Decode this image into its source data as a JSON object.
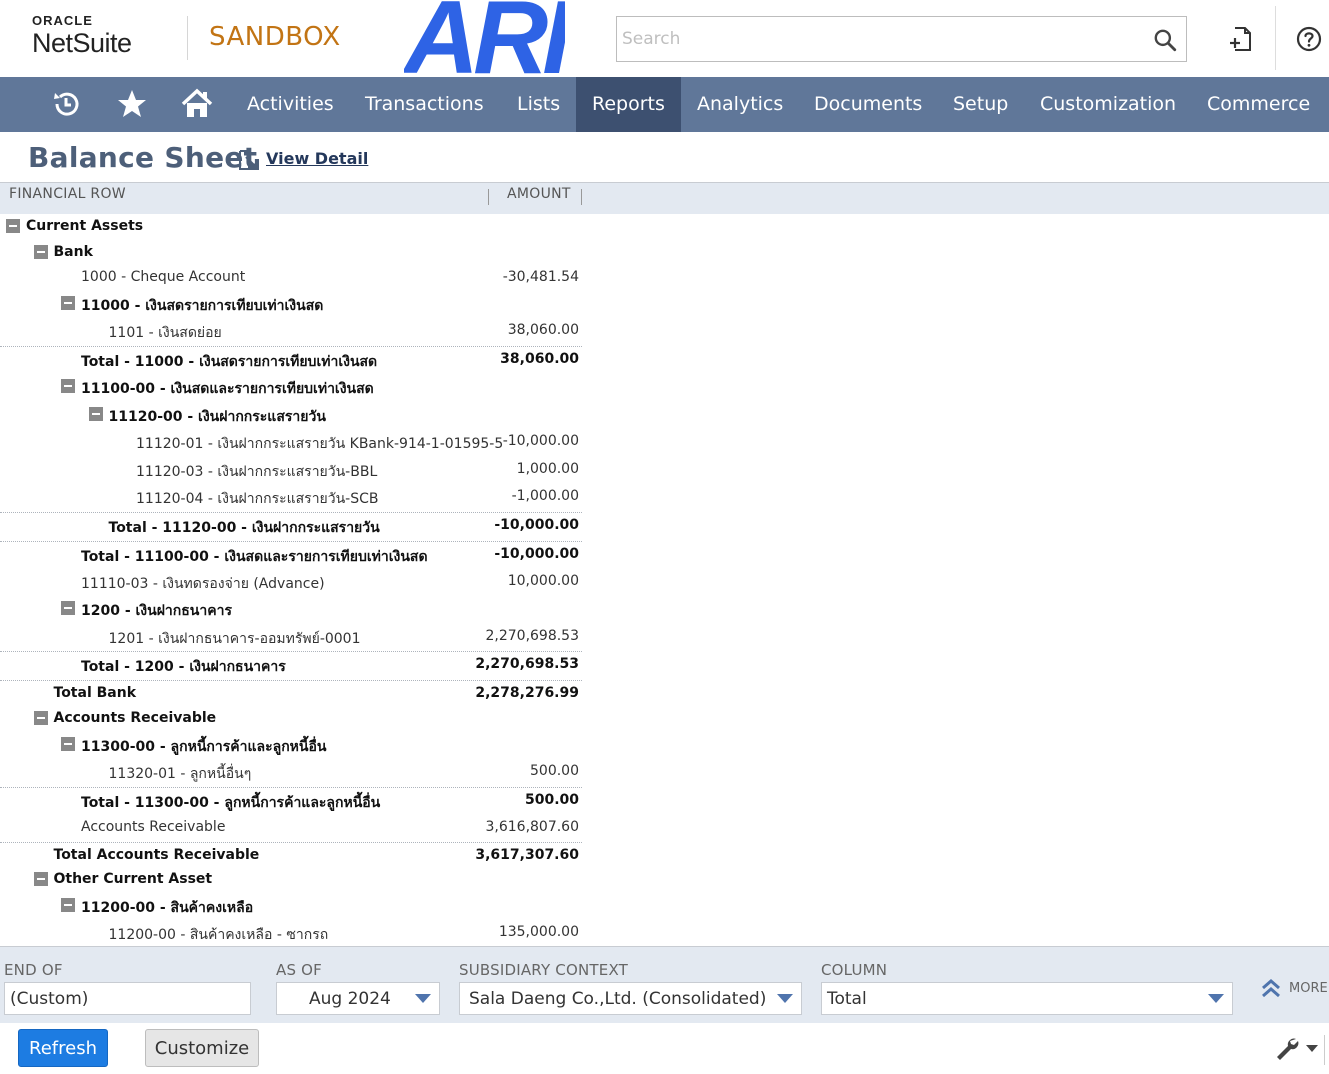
{
  "header": {
    "logo_oracle": "ORACLE",
    "logo_netsuite": "NetSuite",
    "environment": "SANDBOX",
    "brand": "ARI",
    "search_placeholder": "Search"
  },
  "nav": {
    "items": [
      "Activities",
      "Transactions",
      "Lists",
      "Reports",
      "Analytics",
      "Documents",
      "Setup",
      "Customization",
      "Commerce"
    ],
    "active": "Reports"
  },
  "page": {
    "title": "Balance Sheet",
    "view_detail": "View Detail"
  },
  "table": {
    "headers": [
      "FINANCIAL ROW",
      "AMOUNT"
    ],
    "rows": [
      {
        "label": "Current Assets",
        "amount": "",
        "bold": true,
        "collapse": true,
        "indent": 0
      },
      {
        "label": "Bank",
        "amount": "",
        "bold": true,
        "collapse": true,
        "indent": 1
      },
      {
        "label": "1000 - Cheque Account",
        "amount": "-30,481.54",
        "bold": false,
        "collapse": false,
        "indent": 2
      },
      {
        "label": "11000 - เงินสดรายการเทียบเท่าเงินสด",
        "amount": "",
        "bold": true,
        "collapse": true,
        "indent": 2
      },
      {
        "label": "1101 - เงินสดย่อย",
        "amount": "38,060.00",
        "bold": false,
        "collapse": false,
        "indent": 3
      },
      {
        "label": "Total - 11000 - เงินสดรายการเทียบเท่าเงินสด",
        "amount": "38,060.00",
        "bold": true,
        "collapse": false,
        "indent": 2,
        "total": true
      },
      {
        "label": "11100-00 - เงินสดและรายการเทียบเท่าเงินสด",
        "amount": "",
        "bold": true,
        "collapse": true,
        "indent": 2
      },
      {
        "label": "11120-00 - เงินฝากกระแสรายวัน",
        "amount": "",
        "bold": true,
        "collapse": true,
        "indent": 3
      },
      {
        "label": "11120-01 - เงินฝากกระแสรายวัน KBank-914-1-01595-5",
        "amount": "-10,000.00",
        "bold": false,
        "collapse": false,
        "indent": 4
      },
      {
        "label": "11120-03 - เงินฝากกระแสรายวัน-BBL",
        "amount": "1,000.00",
        "bold": false,
        "collapse": false,
        "indent": 4
      },
      {
        "label": "11120-04 - เงินฝากกระแสรายวัน-SCB",
        "amount": "-1,000.00",
        "bold": false,
        "collapse": false,
        "indent": 4
      },
      {
        "label": "Total - 11120-00 - เงินฝากกระแสรายวัน",
        "amount": "-10,000.00",
        "bold": true,
        "collapse": false,
        "indent": 3,
        "total": true
      },
      {
        "label": "Total - 11100-00 - เงินสดและรายการเทียบเท่าเงินสด",
        "amount": "-10,000.00",
        "bold": true,
        "collapse": false,
        "indent": 2,
        "total": true
      },
      {
        "label": "11110-03 - เงินทดรองจ่าย (Advance)",
        "amount": "10,000.00",
        "bold": false,
        "collapse": false,
        "indent": 2
      },
      {
        "label": "1200 - เงินฝากธนาคาร",
        "amount": "",
        "bold": true,
        "collapse": true,
        "indent": 2
      },
      {
        "label": "1201 - เงินฝากธนาคาร-ออมทรัพย์-0001",
        "amount": "2,270,698.53",
        "bold": false,
        "collapse": false,
        "indent": 3
      },
      {
        "label": "Total - 1200 - เงินฝากธนาคาร",
        "amount": "2,270,698.53",
        "bold": true,
        "collapse": false,
        "indent": 2,
        "total": true
      },
      {
        "label": "Total Bank",
        "amount": "2,278,276.99",
        "bold": true,
        "collapse": false,
        "indent": 1,
        "total": true
      },
      {
        "label": "Accounts Receivable",
        "amount": "",
        "bold": true,
        "collapse": true,
        "indent": 1
      },
      {
        "label": "11300-00 - ลูกหนี้การค้าและลูกหนี้อื่น",
        "amount": "",
        "bold": true,
        "collapse": true,
        "indent": 2
      },
      {
        "label": "11320-01 - ลูกหนี้อื่นๆ",
        "amount": "500.00",
        "bold": false,
        "collapse": false,
        "indent": 3
      },
      {
        "label": "Total - 11300-00 - ลูกหนี้การค้าและลูกหนี้อื่น",
        "amount": "500.00",
        "bold": true,
        "collapse": false,
        "indent": 2,
        "total": true
      },
      {
        "label": "Accounts Receivable",
        "amount": "3,616,807.60",
        "bold": false,
        "collapse": false,
        "indent": 2
      },
      {
        "label": "Total Accounts Receivable",
        "amount": "3,617,307.60",
        "bold": true,
        "collapse": false,
        "indent": 1,
        "total": true
      },
      {
        "label": "Other Current Asset",
        "amount": "",
        "bold": true,
        "collapse": true,
        "indent": 1
      },
      {
        "label": "11200-00 - สินค้าคงเหลือ",
        "amount": "",
        "bold": true,
        "collapse": true,
        "indent": 2
      },
      {
        "label": "11200-00 - สินค้าคงเหลือ - ซากรถ",
        "amount": "135,000.00",
        "bold": false,
        "collapse": false,
        "indent": 3
      }
    ]
  },
  "filters": {
    "end_of_label": "END OF",
    "end_of_value": "(Custom)",
    "as_of_label": "AS OF",
    "as_of_value": "Aug 2024",
    "subsidiary_label": "SUBSIDIARY CONTEXT",
    "subsidiary_value": "Sala Daeng Co.,Ltd. (Consolidated)",
    "column_label": "COLUMN",
    "column_value": "Total",
    "more_label": "MORE"
  },
  "actions": {
    "refresh": "Refresh",
    "customize": "Customize"
  },
  "colors": {
    "nav_bg": "#607799",
    "nav_active": "#3d5070",
    "sandbox": "#c27414",
    "brand": "#2e63e5",
    "primary_button": "#1d7ce2"
  }
}
